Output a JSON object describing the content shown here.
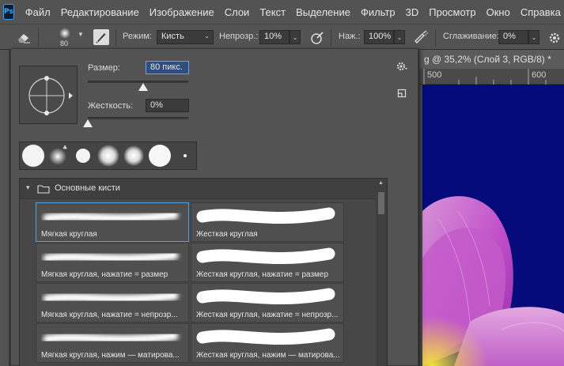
{
  "app": {
    "logo": "Ps"
  },
  "menu": [
    "Файл",
    "Редактирование",
    "Изображение",
    "Слои",
    "Текст",
    "Выделение",
    "Фильтр",
    "3D",
    "Просмотр",
    "Окно",
    "Справка"
  ],
  "options": {
    "brush_size": "80",
    "mode_label": "Режим:",
    "mode_value": "Кисть",
    "opacity_label": "Непрозр.:",
    "opacity_value": "10%",
    "flow_label": "Наж.:",
    "flow_value": "100%",
    "smoothing_label": "Сглаживание:",
    "smoothing_value": "0%"
  },
  "document": {
    "tab_title": "g @ 35,2% (Слой 3, RGB/8) *",
    "ruler_ticks": [
      "500",
      "600"
    ]
  },
  "brush_panel": {
    "size_label": "Размер:",
    "size_value": "80 пикс.",
    "size_slider_pct": 55,
    "hardness_label": "Жесткость:",
    "hardness_value": "0%",
    "hardness_slider_pct": 0,
    "folder_name": "Основные кисти",
    "brushes": [
      "Мягкая круглая",
      "Жесткая круглая",
      "Мягкая круглая, нажатие = размер",
      "Жесткая круглая, нажатие = размер",
      "Мягкая круглая, нажатие = непрозр...",
      "Жесткая круглая, нажатие = непрозр...",
      "Мягкая круглая, нажим — матирова...",
      "Жесткая круглая, нажим — матирова..."
    ]
  },
  "colors": {
    "canvas_bg": "#050b7a",
    "selection": "#4da3e0",
    "ps_blue": "#31a8ff"
  }
}
